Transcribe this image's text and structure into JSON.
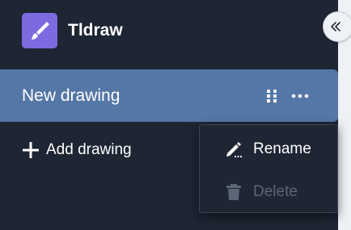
{
  "app": {
    "title": "Tldraw",
    "logo_icon": "paintbrush-icon",
    "logo_color": "#7b6ae0"
  },
  "sidebar": {
    "collapse_icon": "double-chevron-left-icon",
    "drawings": [
      {
        "label": "New drawing",
        "selected": true
      }
    ],
    "add_label": "Add drawing",
    "selected_color": "#5577a6",
    "background_color": "#1e2533"
  },
  "context_menu": {
    "items": [
      {
        "label": "Rename",
        "icon": "pencil-icon",
        "enabled": true
      },
      {
        "label": "Delete",
        "icon": "trash-icon",
        "enabled": false
      }
    ]
  }
}
